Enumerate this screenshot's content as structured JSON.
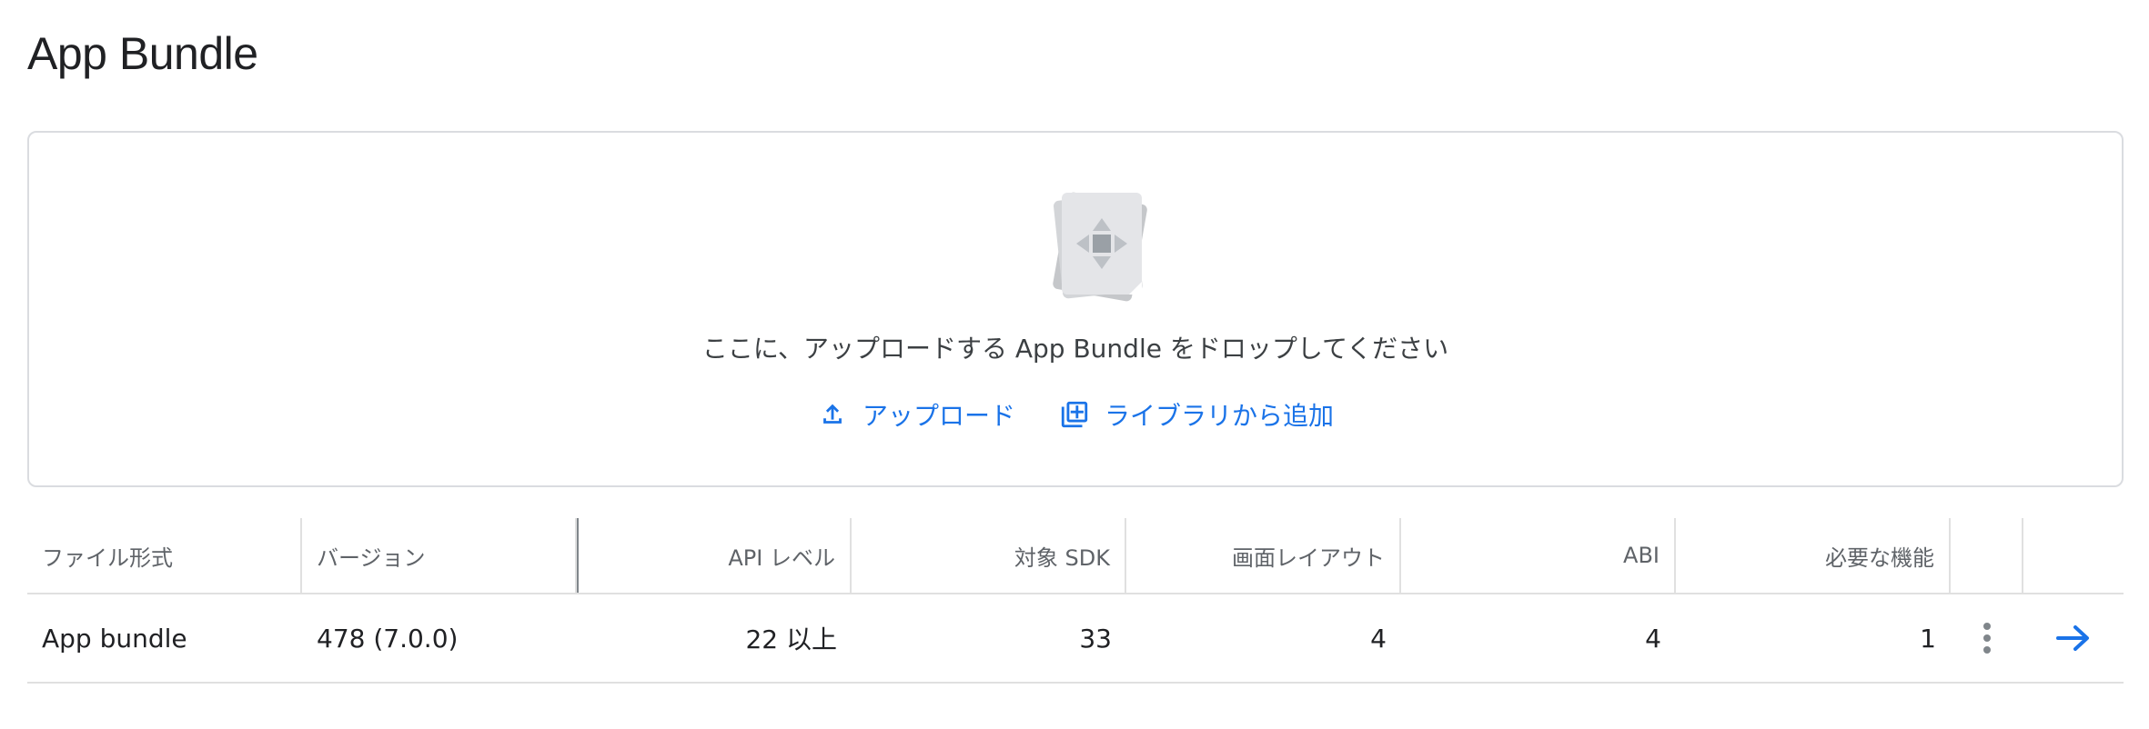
{
  "page": {
    "title": "App Bundle"
  },
  "dropzone": {
    "instruction": "ここに、アップロードする App Bundle をドロップしてください",
    "upload_label": "アップロード",
    "library_label": "ライブラリから追加",
    "art_icon": "app-bundle-icon"
  },
  "table": {
    "headers": {
      "file_format": "ファイル形式",
      "version": "バージョン",
      "api_level": "API レベル",
      "target_sdk": "対象 SDK",
      "screen_layout": "画面レイアウト",
      "abi": "ABI",
      "required_features": "必要な機能"
    },
    "rows": [
      {
        "file_format": "App bundle",
        "version": "478 (7.0.0)",
        "api_level": "22 以上",
        "target_sdk": "33",
        "screen_layout": "4",
        "abi": "4",
        "required_features": "1"
      }
    ]
  },
  "colors": {
    "accent": "#1a73e8",
    "border": "#dadce0",
    "text": "#202124",
    "muted": "#5f6368"
  }
}
